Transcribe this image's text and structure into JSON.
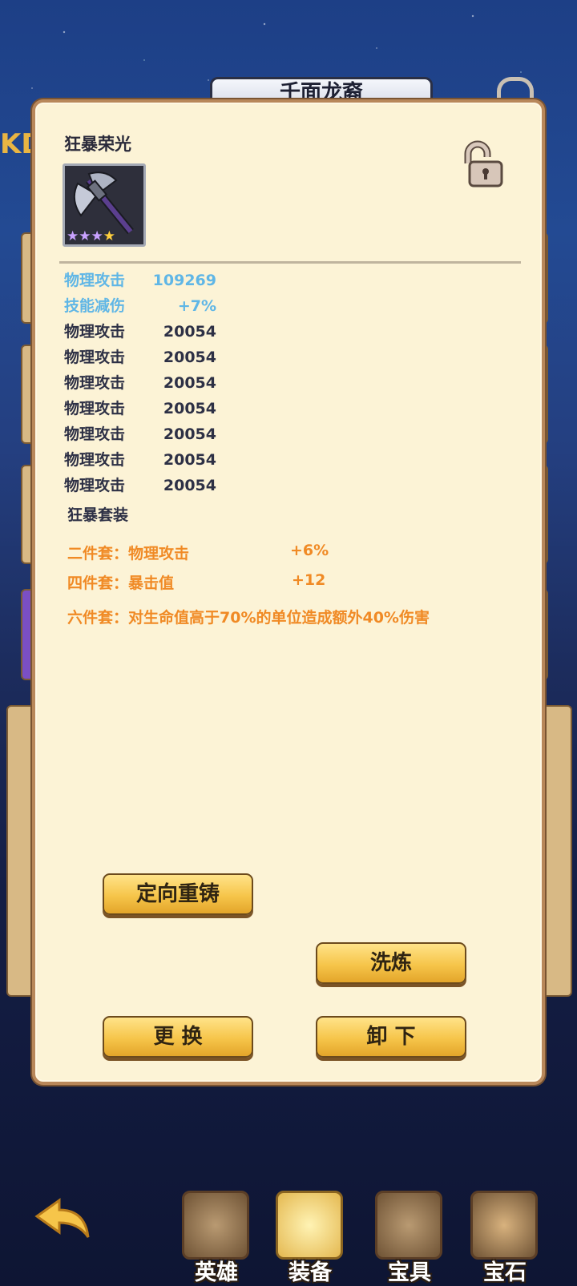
{
  "background": {
    "title_plate": "千面龙裔",
    "kd_fragment": "KD"
  },
  "item": {
    "name": "狂暴荣光",
    "icon": "battle-axe-icon",
    "lock_state": "unlocked-padlock-icon",
    "stars": {
      "filled_purple": 3,
      "filled_gold": 1
    }
  },
  "stats": [
    {
      "label": "物理攻击",
      "value": "109269",
      "color": "#5fb6e6"
    },
    {
      "label": "技能减伤",
      "value": "+7%",
      "color": "#5fb6e6"
    },
    {
      "label": "物理攻击",
      "value": "20054",
      "color": "#2d3045"
    },
    {
      "label": "物理攻击",
      "value": "20054",
      "color": "#2d3045"
    },
    {
      "label": "物理攻击",
      "value": "20054",
      "color": "#2d3045"
    },
    {
      "label": "物理攻击",
      "value": "20054",
      "color": "#2d3045"
    },
    {
      "label": "物理攻击",
      "value": "20054",
      "color": "#2d3045"
    },
    {
      "label": "物理攻击",
      "value": "20054",
      "color": "#2d3045"
    },
    {
      "label": "物理攻击",
      "value": "20054",
      "color": "#2d3045"
    }
  ],
  "set": {
    "title": "狂暴套装",
    "two_piece": {
      "label": "二件套：物理攻击",
      "value": "+6%"
    },
    "four_piece": {
      "label": "四件套：暴击值",
      "value": "+12"
    },
    "six_piece": {
      "label": "六件套：对生命值高于70%的单位造成额外40%伤害"
    }
  },
  "buttons": {
    "reforge": "定向重铸",
    "refine": "洗炼",
    "replace": "更 换",
    "unequip": "卸 下"
  },
  "nav": {
    "back_icon": "back-arrow-icon",
    "items": [
      {
        "label": "英雄",
        "icon": "helmet-icon"
      },
      {
        "label": "装备",
        "icon": "sword-shield-icon"
      },
      {
        "label": "宝具",
        "icon": "crossed-swords-icon"
      },
      {
        "label": "宝石",
        "icon": "crystal-icon"
      }
    ]
  },
  "colors": {
    "panel": "#fcf3d6",
    "accent_blue": "#5fb6e6",
    "accent_orange": "#f08a25",
    "button_gold": "#f6c54a"
  }
}
